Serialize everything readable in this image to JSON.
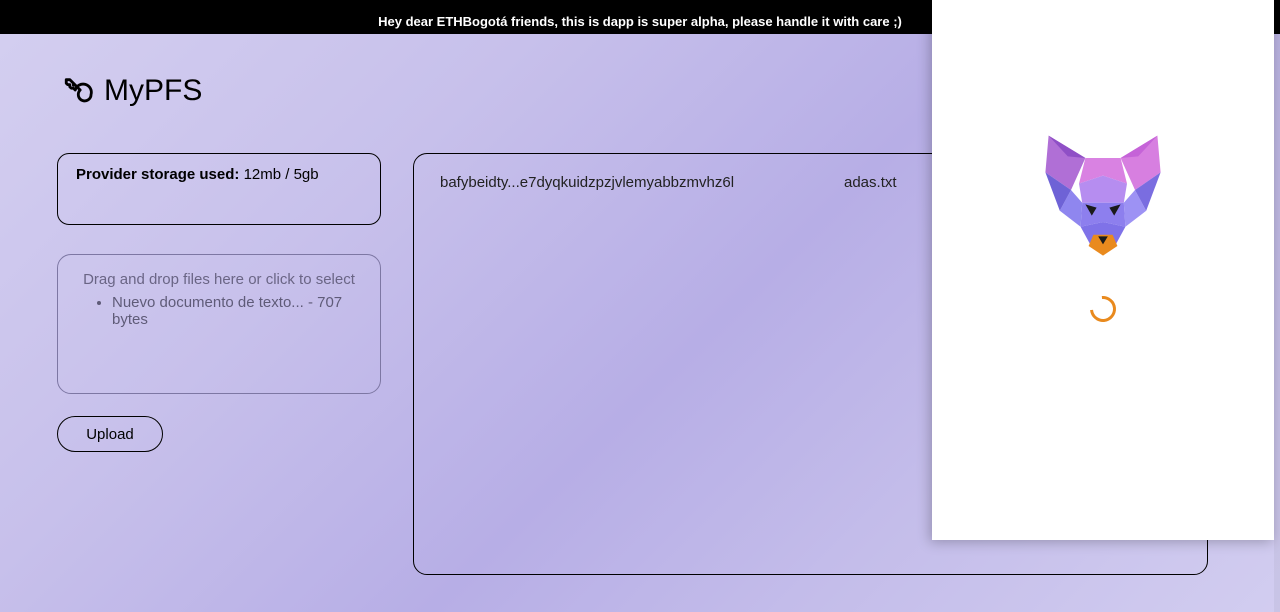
{
  "banner": {
    "text": "Hey dear ETHBogotá friends, this is dapp is super alpha, please handle it with care ;)"
  },
  "app": {
    "name": "MyPFS",
    "logo_icon": "key-icon"
  },
  "storage": {
    "label": "Provider storage used:",
    "value": "12mb / 5gb"
  },
  "dropzone": {
    "hint": "Drag and drop files here or click to select",
    "files": [
      {
        "display": "Nuevo documento de texto... - 707 bytes"
      }
    ]
  },
  "buttons": {
    "upload": "Upload"
  },
  "file_list": {
    "rows": [
      {
        "cid": "bafybeidty...e7dyqkuidzpzjvlemyabbzmvhz6l",
        "name": "adas.txt"
      }
    ]
  },
  "wallet_popup": {
    "icon": "metamask-fox-icon",
    "state": "loading"
  },
  "colors": {
    "bg_gradient_a": "#d4cff0",
    "bg_gradient_b": "#b7aee6",
    "spinner": "#e98a1e"
  }
}
